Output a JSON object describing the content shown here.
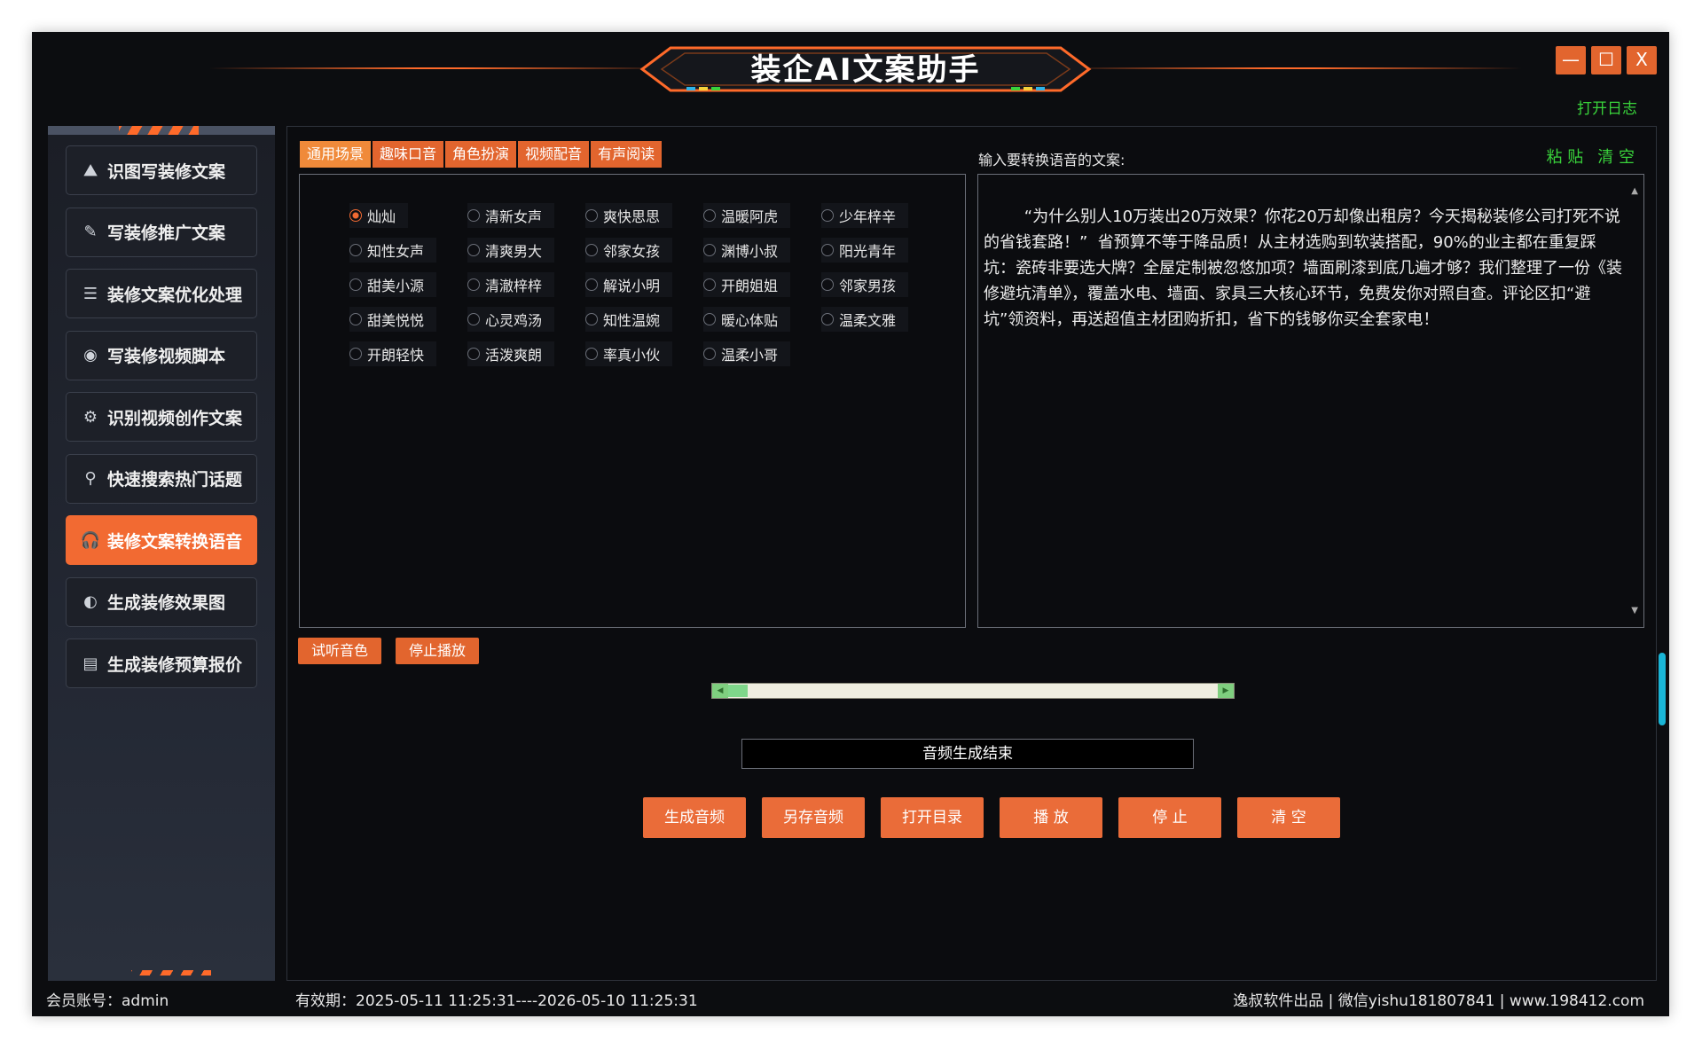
{
  "app": {
    "title": "装企AI文案助手",
    "window_controls": {
      "minimize": "—",
      "maximize": "☐",
      "close": "X"
    },
    "open_log": "打开日志"
  },
  "sidebar": {
    "items": [
      {
        "label": "识图写装修文案",
        "icon": "image-icon",
        "glyph": "⛰"
      },
      {
        "label": "写装修推广文案",
        "icon": "pen-icon",
        "glyph": "✎"
      },
      {
        "label": "装修文案优化处理",
        "icon": "document-icon",
        "glyph": "☰"
      },
      {
        "label": "写装修视频脚本",
        "icon": "camera-icon",
        "glyph": "◉"
      },
      {
        "label": "识别视频创作文案",
        "icon": "settings-icon",
        "glyph": "⚙"
      },
      {
        "label": "快速搜索热门话题",
        "icon": "location-pin-icon",
        "glyph": "⚲"
      },
      {
        "label": "装修文案转换语音",
        "icon": "headphones-icon",
        "glyph": "🎧"
      },
      {
        "label": "生成装修效果图",
        "icon": "palette-icon",
        "glyph": "◐"
      },
      {
        "label": "生成装修预算报价",
        "icon": "table-icon",
        "glyph": "▤"
      }
    ],
    "active_index": 6
  },
  "tabs": [
    "通用场景",
    "趣味口音",
    "角色扮演",
    "视频配音",
    "有声阅读"
  ],
  "voices": {
    "rows": [
      [
        "灿灿",
        "清新女声",
        "爽快思思",
        "温暖阿虎",
        "少年梓辛"
      ],
      [
        "知性女声",
        "清爽男大",
        "邻家女孩",
        "渊博小叔",
        "阳光青年"
      ],
      [
        "甜美小源",
        "清澈梓梓",
        "解说小明",
        "开朗姐姐",
        "邻家男孩"
      ],
      [
        "甜美悦悦",
        "心灵鸡汤",
        "知性温婉",
        "暖心体贴",
        "温柔文雅"
      ],
      [
        "开朗轻快",
        "活泼爽朗",
        "率真小伙",
        "温柔小哥"
      ]
    ],
    "selected": "灿灿"
  },
  "text_panel": {
    "label": "输入要转换语音的文案:",
    "paste": "粘 贴",
    "clear": "清 空",
    "content": "  “为什么别人10万装出20万效果？你花20万却像出租房？今天揭秘装修公司打死不说的省钱套路！”  省预算不等于降品质！从主材选购到软装搭配，90%的业主都在重复踩坑：瓷砖非要选大牌？全屋定制被忽悠加项？墙面刷漆到底几遍才够？我们整理了一份《装修避坑清单》，覆盖水电、墙面、家具三大核心环节，免费发你对照自查。评论区扣“避坑”领资料，再送超值主材团购折扣，省下的钱够你买全套家电！"
  },
  "preview_buttons": {
    "listen": "试听音色",
    "stop": "停止播放"
  },
  "progress": {
    "percent": 4
  },
  "status": "音频生成结束",
  "actions": [
    "生成音频",
    "另存音频",
    "打开目录",
    "播  放",
    "停  止",
    "清  空"
  ],
  "footer": {
    "account": "会员账号：admin",
    "validity": "有效期：2025-05-11 11:25:31----2026-05-10 11:25:31",
    "credits": "逸叔软件出品 | 微信yishu181807841 | www.198412.com"
  },
  "colors": {
    "accent": "#e2652e",
    "green": "#39d23b",
    "background": "#0b0c0f"
  }
}
